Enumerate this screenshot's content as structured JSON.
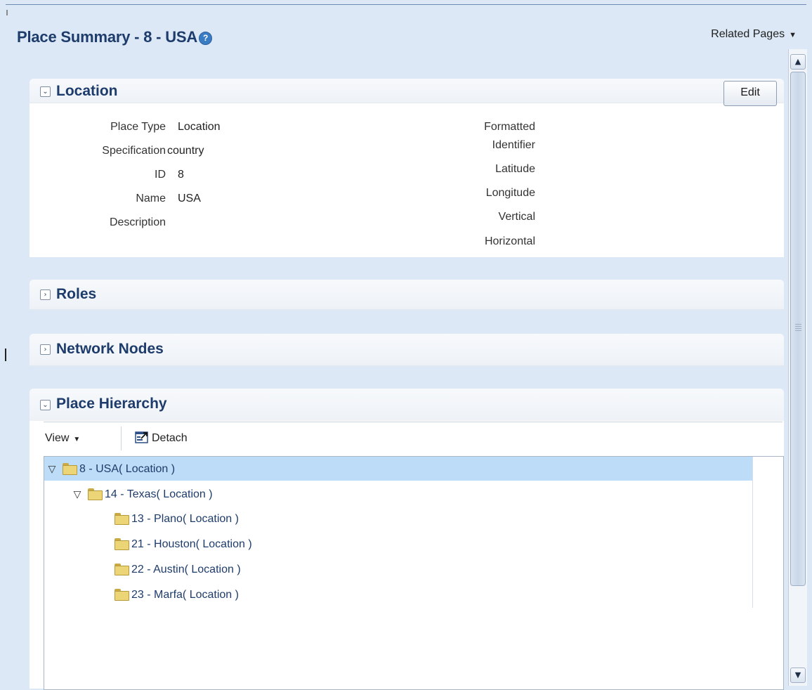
{
  "header": {
    "title": "Place Summary - 8 - USA",
    "help_glyph": "?",
    "related_pages_label": "Related Pages"
  },
  "location": {
    "title": "Location",
    "edit_label": "Edit",
    "left_fields": [
      {
        "label": "Place Type",
        "value": "Location"
      },
      {
        "label": "Specification",
        "value": "country"
      },
      {
        "label": "ID",
        "value": "8"
      },
      {
        "label": "Name",
        "value": "USA"
      },
      {
        "label": "Description",
        "value": ""
      }
    ],
    "right_fields": [
      {
        "label": "Formatted",
        "value": ""
      },
      {
        "label": "Identifier",
        "value": ""
      },
      {
        "label": "Latitude",
        "value": ""
      },
      {
        "label": "Longitude",
        "value": ""
      },
      {
        "label": "Vertical",
        "value": ""
      },
      {
        "label": "Horizontal",
        "value": ""
      }
    ]
  },
  "roles": {
    "title": "Roles"
  },
  "network_nodes": {
    "title": "Network Nodes"
  },
  "place_hierarchy": {
    "title": "Place Hierarchy",
    "toolbar": {
      "view_label": "View",
      "detach_label": "Detach"
    },
    "nodes": [
      {
        "label": "8 - USA( Location )",
        "expanded": true,
        "selected": true,
        "level": 0
      },
      {
        "label": "14 - Texas( Location )",
        "expanded": true,
        "selected": false,
        "level": 1
      },
      {
        "label": "13 - Plano( Location )",
        "expanded": false,
        "selected": false,
        "level": 2
      },
      {
        "label": "21 - Houston( Location )",
        "expanded": false,
        "selected": false,
        "level": 2
      },
      {
        "label": "22 - Austin( Location )",
        "expanded": false,
        "selected": false,
        "level": 2
      },
      {
        "label": "23 - Marfa( Location )",
        "expanded": false,
        "selected": false,
        "level": 2
      }
    ]
  },
  "icons": {
    "help": "help-icon",
    "related_caret": "chevron-down-icon",
    "expanded_section": "chevron-down-icon",
    "collapsed_section": "chevron-right-icon",
    "folder": "folder-icon",
    "detach": "detach-icon",
    "tree_expanded": "triangle-down-icon"
  },
  "colors": {
    "page_bg": "#dce8f6",
    "title": "#1e3c6b",
    "selected_row": "#bcdcf7",
    "folder": "#ecd577"
  }
}
